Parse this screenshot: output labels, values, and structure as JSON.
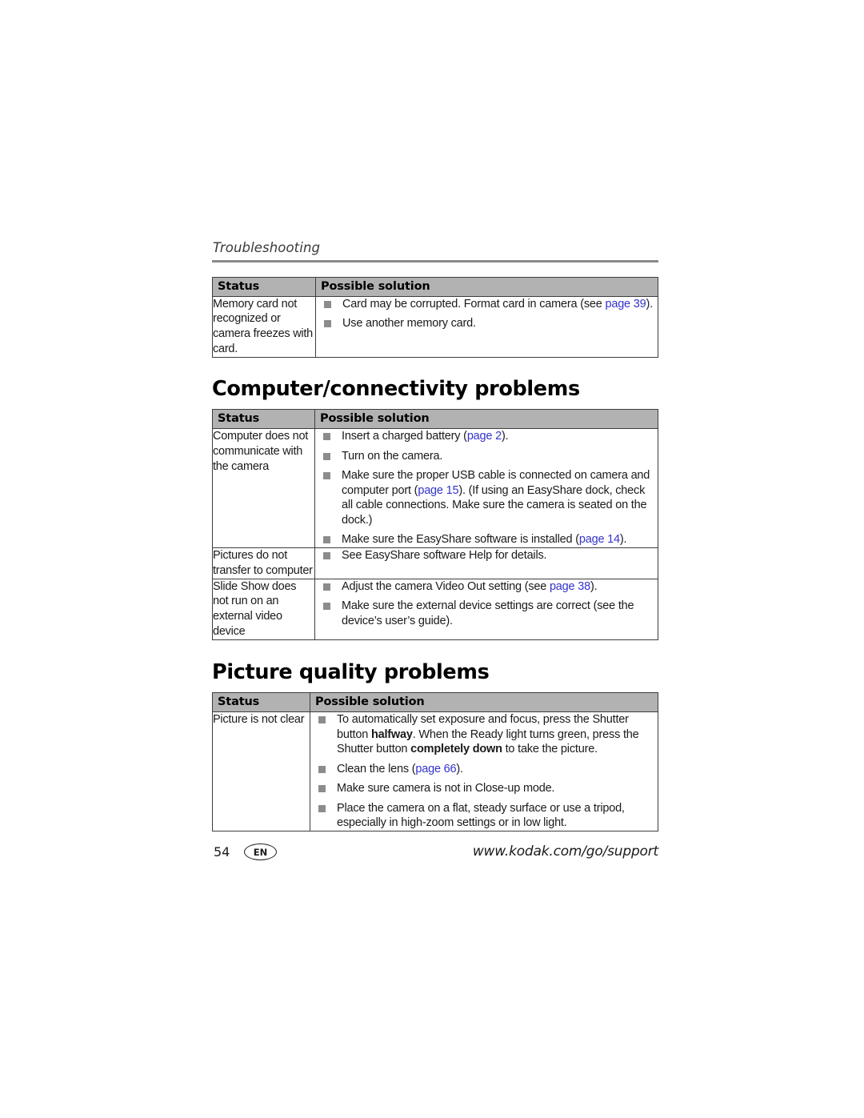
{
  "running_head": "Troubleshooting",
  "table_headers": {
    "status": "Status",
    "solution": "Possible solution"
  },
  "memory_card_table": {
    "rows": [
      {
        "status": "Memory card not recognized or camera freezes with card.",
        "bullets": [
          {
            "parts": [
              {
                "text": "Card may be corrupted. Format card in camera (see ",
                "style": "normal"
              },
              {
                "text": "page 39",
                "style": "link"
              },
              {
                "text": ").",
                "style": "normal"
              }
            ]
          },
          {
            "parts": [
              {
                "text": "Use another memory card.",
                "style": "normal"
              }
            ]
          }
        ]
      }
    ]
  },
  "computer_section": {
    "heading": "Computer/connectivity problems",
    "rows": [
      {
        "status": "Computer does not communicate with the camera",
        "bullets": [
          {
            "parts": [
              {
                "text": "Insert a charged battery (",
                "style": "normal"
              },
              {
                "text": "page 2",
                "style": "link"
              },
              {
                "text": ").",
                "style": "normal"
              }
            ]
          },
          {
            "parts": [
              {
                "text": "Turn on the camera.",
                "style": "normal"
              }
            ]
          },
          {
            "parts": [
              {
                "text": "Make sure the proper USB cable is connected on camera and computer port (",
                "style": "normal"
              },
              {
                "text": "page 15",
                "style": "link"
              },
              {
                "text": "). (If using an EasyShare dock, check all cable connections. Make sure the camera is seated on the dock.)",
                "style": "normal"
              }
            ]
          },
          {
            "parts": [
              {
                "text": "Make sure the EasyShare software is installed (",
                "style": "normal"
              },
              {
                "text": "page 14",
                "style": "link"
              },
              {
                "text": ").",
                "style": "normal"
              }
            ]
          }
        ]
      },
      {
        "status": "Pictures do not transfer to computer",
        "bullets": [
          {
            "parts": [
              {
                "text": "See EasyShare software Help for details.",
                "style": "normal"
              }
            ]
          }
        ]
      },
      {
        "status": "Slide Show does not run on an external video device",
        "bullets": [
          {
            "parts": [
              {
                "text": "Adjust the camera Video Out setting (see ",
                "style": "normal"
              },
              {
                "text": "page 38",
                "style": "link"
              },
              {
                "text": ").",
                "style": "normal"
              }
            ]
          },
          {
            "parts": [
              {
                "text": "Make sure the external device settings are correct (see the device’s user’s guide).",
                "style": "normal"
              }
            ]
          }
        ]
      }
    ]
  },
  "picture_section": {
    "heading": "Picture quality problems",
    "rows": [
      {
        "status": "Picture is not clear",
        "bullets": [
          {
            "parts": [
              {
                "text": "To automatically set exposure and focus, press the Shutter button ",
                "style": "normal"
              },
              {
                "text": "halfway",
                "style": "bold"
              },
              {
                "text": ". When the Ready light turns green, press the Shutter button ",
                "style": "normal"
              },
              {
                "text": "completely down",
                "style": "bold"
              },
              {
                "text": " to take the picture.",
                "style": "normal"
              }
            ]
          },
          {
            "parts": [
              {
                "text": "Clean the lens (",
                "style": "normal"
              },
              {
                "text": "page 66",
                "style": "link"
              },
              {
                "text": ").",
                "style": "normal"
              }
            ]
          },
          {
            "parts": [
              {
                "text": "Make sure camera is not in Close-up mode.",
                "style": "normal"
              }
            ]
          },
          {
            "parts": [
              {
                "text": "Place the camera on a flat, steady surface or use a tripod, especially in high-zoom settings or in low light.",
                "style": "normal"
              }
            ]
          }
        ]
      }
    ]
  },
  "footer": {
    "page_number": "54",
    "language_badge": "EN",
    "support_url": "www.kodak.com/go/support"
  },
  "colors": {
    "link": "#3333cc",
    "header_row_bg": "#b2b2b2",
    "bullet": "#8c8c8c",
    "rule": "#8a8a8a",
    "border": "#3d3d3d"
  }
}
